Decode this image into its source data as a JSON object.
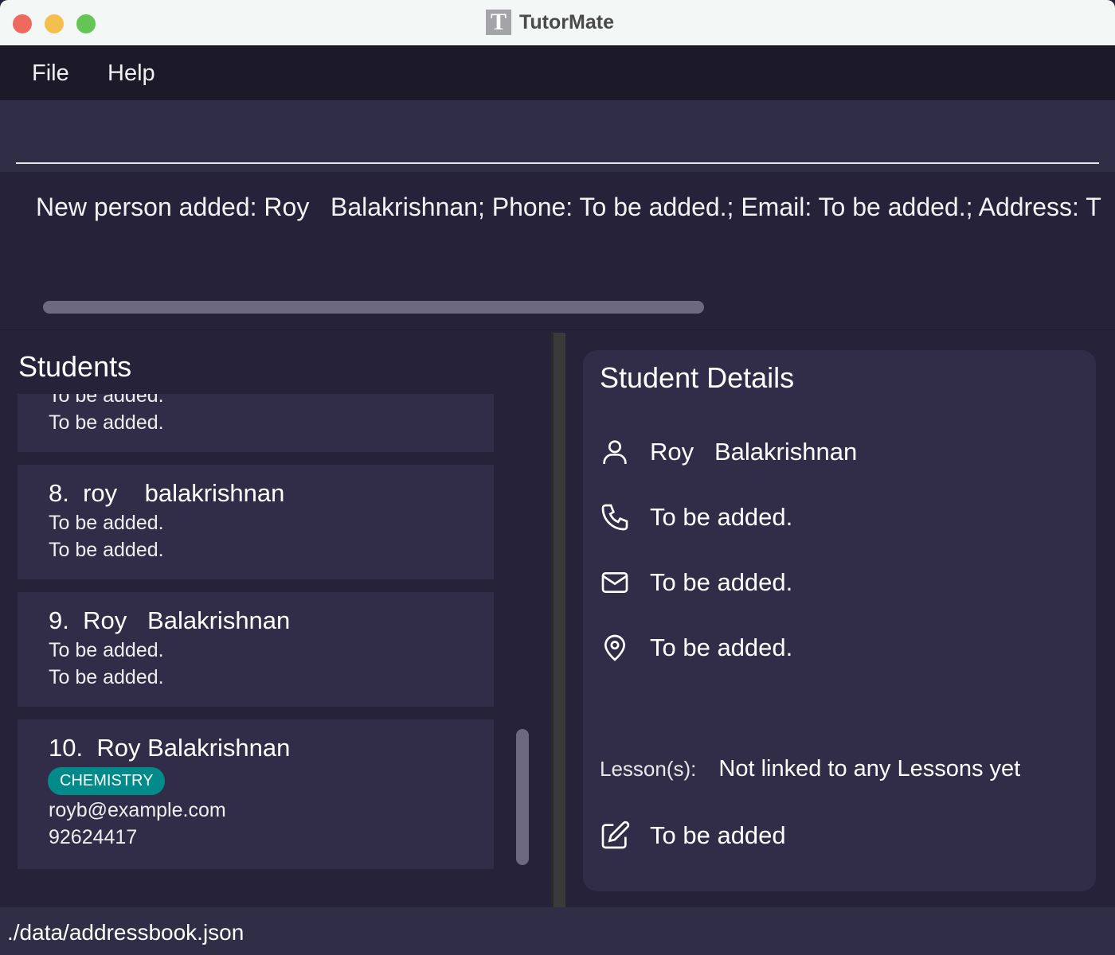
{
  "window": {
    "title": "TutorMate",
    "logo_letter": "T"
  },
  "menu": {
    "file": "File",
    "help": "Help"
  },
  "command": {
    "value": "",
    "placeholder": ""
  },
  "result": {
    "text": "New person added: Roy   Balakrishnan; Phone: To be added.; Email: To be added.; Address: T"
  },
  "students": {
    "title": "Students",
    "partial_card": {
      "line1": "To be added.",
      "line2": "To be added."
    },
    "cards": [
      {
        "index": "8.",
        "name": "roy    balakrishnan",
        "line1": "To be added.",
        "line2": "To be added."
      },
      {
        "index": "9.",
        "name": "Roy   Balakrishnan",
        "line1": "To be added.",
        "line2": "To be added."
      },
      {
        "index": "10.",
        "name": "Roy Balakrishnan",
        "tag": "CHEMISTRY",
        "line1": "royb@example.com",
        "line2": "92624417"
      }
    ]
  },
  "details": {
    "title": "Student Details",
    "name": "Roy   Balakrishnan",
    "phone": "To be added.",
    "email": "To be added.",
    "address": "To be added.",
    "lessons_label": "Lesson(s):",
    "lessons_value": "Not linked to any Lessons yet",
    "note": "To be added"
  },
  "status": {
    "path": "./data/addressbook.json"
  },
  "colors": {
    "tag": "#008a8a",
    "card": "#312d48",
    "background": "#25223a"
  }
}
